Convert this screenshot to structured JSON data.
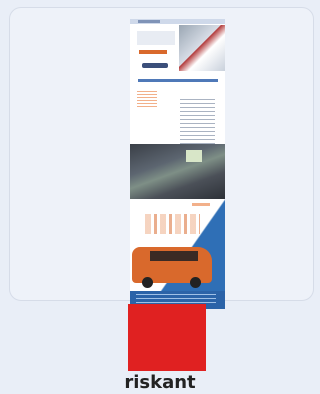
{
  "status": {
    "label": "riskant",
    "color": "#e02121"
  },
  "colors": {
    "page_background": "#e9eef7",
    "card_background": "#eef2f9",
    "preview_accent_blue": "#2f6fb6",
    "preview_accent_orange": "#d9692c"
  }
}
